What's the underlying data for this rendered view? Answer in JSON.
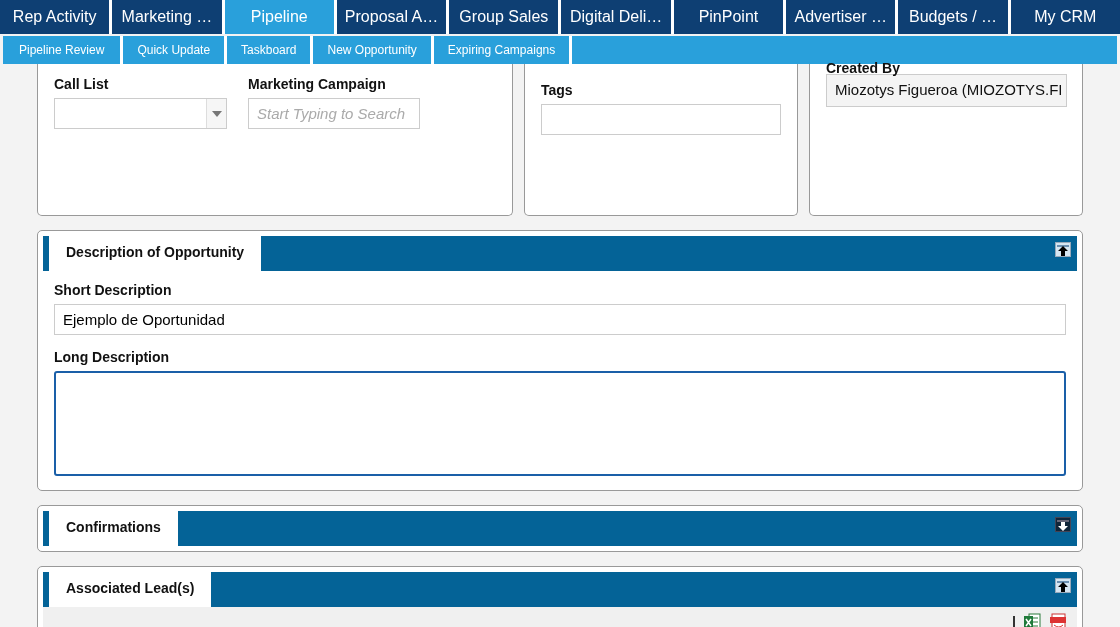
{
  "main_tabs": [
    {
      "label": "Rep Activity",
      "selected": false
    },
    {
      "label": "Marketing …",
      "selected": false
    },
    {
      "label": "Pipeline",
      "selected": true
    },
    {
      "label": "Proposal A…",
      "selected": false
    },
    {
      "label": "Group Sales",
      "selected": false
    },
    {
      "label": "Digital Deli…",
      "selected": false
    },
    {
      "label": "PinPoint",
      "selected": false
    },
    {
      "label": "Advertiser …",
      "selected": false
    },
    {
      "label": "Budgets / …",
      "selected": false
    },
    {
      "label": "My CRM",
      "selected": false
    }
  ],
  "sub_tabs": [
    "Pipeline Review",
    "Quick Update",
    "Taskboard",
    "New Opportunity",
    "Expiring Campaigns"
  ],
  "top_cards": {
    "call_list": {
      "label": "Call List"
    },
    "marketing_campaign": {
      "label": "Marketing Campaign",
      "placeholder": "Start Typing to Search"
    },
    "tags": {
      "label": "Tags"
    },
    "created_by": {
      "label": "Created By",
      "value": "Miozotys Figueroa (MIOZOTYS.FI"
    }
  },
  "panels": [
    {
      "kind": "description",
      "title": "Description of Opportunity",
      "expanded": true,
      "short_label": "Short Description",
      "short_value": "Ejemplo de Oportunidad",
      "long_label": "Long Description"
    },
    {
      "kind": "plain",
      "title": "Confirmations",
      "expanded": false
    },
    {
      "kind": "leads",
      "title": "Associated Lead(s)",
      "expanded": true
    }
  ]
}
